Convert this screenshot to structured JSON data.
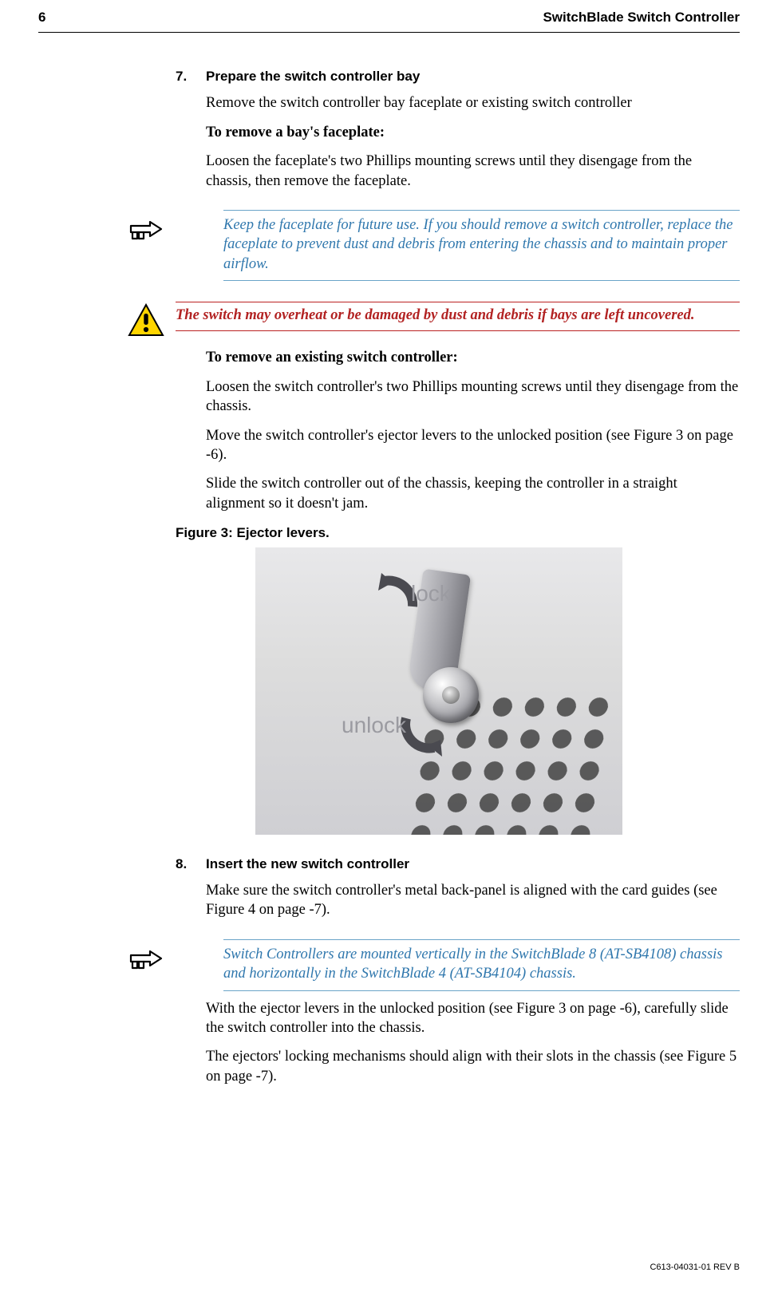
{
  "header": {
    "page_number": "6",
    "title": "SwitchBlade Switch Controller"
  },
  "step7": {
    "num": "7.",
    "title": "Prepare the switch controller bay",
    "p1": "Remove the switch controller bay faceplate or existing switch controller",
    "h1": "To remove a bay's faceplate:",
    "p2": "Loosen the faceplate's two Phillips mounting screws until they disengage from the chassis, then remove the faceplate."
  },
  "note1": {
    "text": "Keep the faceplate for future use. If you should remove a switch controller, replace the faceplate to prevent dust and debris from entering the chassis and to maintain proper airflow."
  },
  "warn1": {
    "text": "The switch may overheat or be damaged by dust and debris if bays are left uncovered."
  },
  "remove_existing": {
    "h": "To remove an existing switch controller:",
    "p1": "Loosen the switch controller's two Phillips mounting screws until they disengage from the chassis.",
    "p2": "Move the switch controller's ejector levers to the unlocked position (see Figure 3 on page -6).",
    "p3": "Slide the switch controller out of the chassis, keeping the controller in a straight alignment so it doesn't jam."
  },
  "figure3": {
    "caption": "Figure 3: Ejector levers.",
    "label_lock": "lock",
    "label_unlock": "unlock"
  },
  "step8": {
    "num": "8.",
    "title": "Insert the new switch controller",
    "p1": "Make sure the switch controller's metal back-panel is aligned with the card guides (see Figure 4 on page -7)."
  },
  "note2": {
    "text": "Switch Controllers are mounted vertically in the SwitchBlade 8 (AT-SB4108) chassis and horizontally in the SwitchBlade 4 (AT-SB4104) chassis."
  },
  "after_note2": {
    "p1": "With the ejector levers in the unlocked position (see Figure 3 on page -6), carefully slide the switch controller into the chassis.",
    "p2": "The ejectors' locking mechanisms should align with their slots in the chassis (see Figure 5 on page -7)."
  },
  "footer": {
    "doc_id": "C613-04031-01 REV B"
  }
}
